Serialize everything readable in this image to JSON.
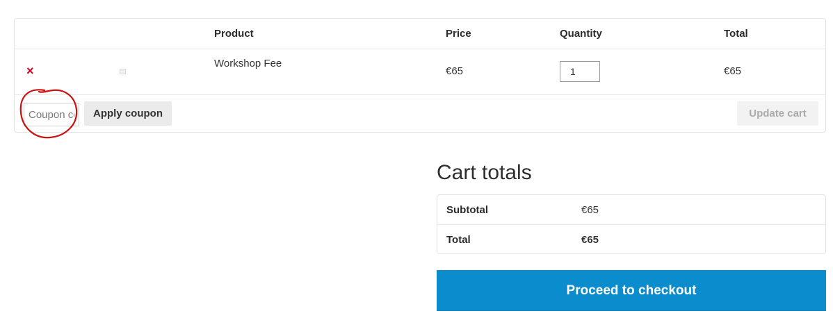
{
  "cart_table": {
    "headers": {
      "product": "Product",
      "price": "Price",
      "quantity": "Quantity",
      "total": "Total"
    },
    "items": [
      {
        "remove_icon": "×",
        "name": "Workshop Fee",
        "price": "€65",
        "quantity": "1",
        "total": "€65"
      }
    ]
  },
  "coupon": {
    "placeholder": "Coupon code",
    "apply_label": "Apply coupon"
  },
  "update_cart_label": "Update cart",
  "cart_totals": {
    "title": "Cart totals",
    "subtotal_label": "Subtotal",
    "subtotal_value": "€65",
    "total_label": "Total",
    "total_value": "€65"
  },
  "checkout_label": "Proceed to checkout",
  "colors": {
    "accent": "#0a8ccd",
    "remove": "#d0021b",
    "annotation": "#cc1111"
  }
}
